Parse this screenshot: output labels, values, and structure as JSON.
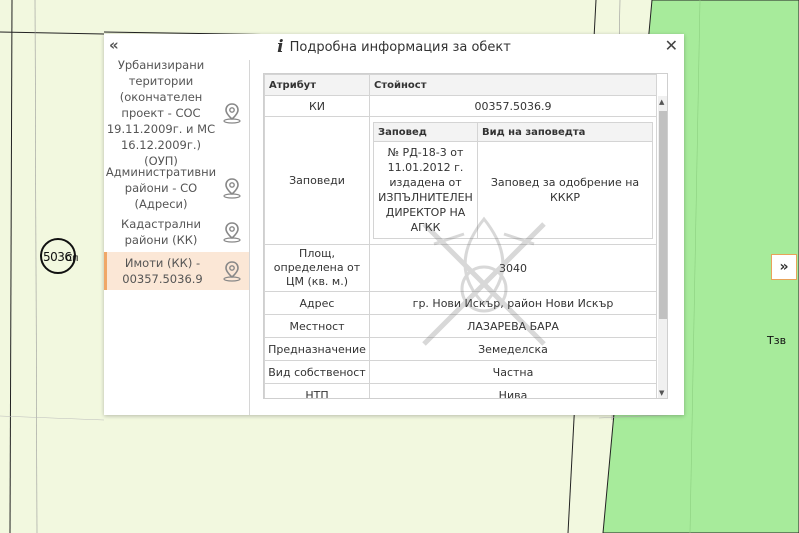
{
  "map": {
    "parcel_label": "5036",
    "parcel_suffix": "Сп",
    "zone_label": "Тзв",
    "expand_icon": "»"
  },
  "dialog": {
    "title": "Подробна информация за обект",
    "collapse_icon": "«",
    "close_icon": "✕",
    "info_icon": "i"
  },
  "layers": [
    {
      "label": "Урбанизирани територии (окончателен проект - СОС 19.11.2009г. и МС 16.12.2009г.) (ОУП)",
      "icon": "map-pin-icon"
    },
    {
      "label": "Административни райони - СО (Адреси)",
      "icon": "map-pin-icon"
    },
    {
      "label": "Кадастрални райони (КК)",
      "icon": "map-pin-icon"
    },
    {
      "label": "Имоти (КК) - 00357.5036.9",
      "icon": "map-pin-icon",
      "active": true
    }
  ],
  "table": {
    "col_attr": "Атрибут",
    "col_value": "Стойност",
    "rows": {
      "ki": {
        "name": "КИ",
        "value": "00357.5036.9"
      },
      "orders": {
        "name": "Заповеди",
        "col_order": "Заповед",
        "col_type": "Вид на заповедта",
        "order": "№ РД-18-3 от 11.01.2012 г. издадена от ИЗПЪЛНИТЕЛЕН ДИРЕКТОР НА АГКК",
        "type": "Заповед за одобрение на КККР"
      },
      "area": {
        "name": "Площ, определена от ЦМ (кв. м.)",
        "value": "3040"
      },
      "address": {
        "name": "Адрес",
        "value": "гр. Нови Искър, район Нови Искър"
      },
      "locality": {
        "name": "Местност",
        "value": "ЛАЗАРЕВА БАРА"
      },
      "purpose": {
        "name": "Предназначение",
        "value": "Земеделска"
      },
      "ownership": {
        "name": "Вид собственост",
        "value": "Частна"
      },
      "ntp": {
        "name": "НТП",
        "value": "Нива"
      }
    }
  },
  "colors": {
    "map_bg": "#f2f8df",
    "green_zone": "#a7eb9b",
    "active_layer": "#fbe7d6",
    "accent_orange": "#f0a868"
  }
}
